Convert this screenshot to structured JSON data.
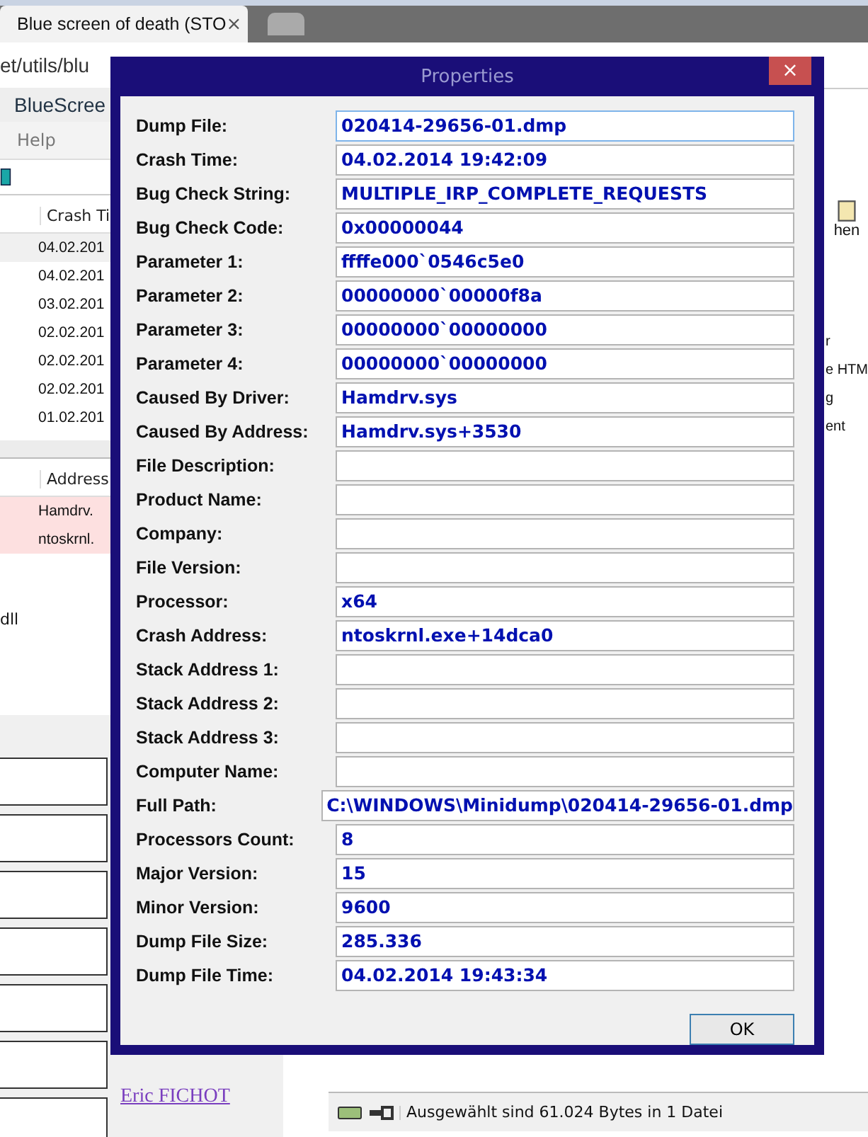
{
  "browser": {
    "tab_title": "Blue screen of death (STO",
    "tab_close": "×",
    "address": "et/utils/blu"
  },
  "app_window": {
    "title": "BlueScree",
    "menu": [
      "Help"
    ],
    "crash_list": {
      "column": "Crash Ti",
      "rows": [
        "04.02.201",
        "04.02.201",
        "03.02.201",
        "02.02.201",
        "02.02.201",
        "02.02.201",
        "01.02.201"
      ]
    },
    "driver_list": {
      "column": "Address",
      "rows": [
        {
          "text": "Hamdrv.",
          "highlighted": true
        },
        {
          "text": "ntoskrnl.",
          "highlighted": true
        }
      ],
      "extra": "dll"
    },
    "right_panel": {
      "button_label": "hen",
      "items": [
        "r",
        "e HTM",
        "g",
        "ent"
      ]
    }
  },
  "web_page": {
    "link": "Eric FICHOT"
  },
  "status_bar": {
    "text": "Ausgewählt sind 61.024 Bytes in 1 Datei"
  },
  "dialog": {
    "title": "Properties",
    "close": "×",
    "ok": "OK",
    "fields": [
      {
        "label": "Dump File:",
        "value": "020414-29656-01.dmp",
        "focused": true
      },
      {
        "label": "Crash Time:",
        "value": "04.02.2014 19:42:09",
        "focused": false
      },
      {
        "label": "Bug Check String:",
        "value": "MULTIPLE_IRP_COMPLETE_REQUESTS",
        "focused": false
      },
      {
        "label": "Bug Check Code:",
        "value": "0x00000044",
        "focused": false
      },
      {
        "label": "Parameter 1:",
        "value": "ffffe000`0546c5e0",
        "focused": false
      },
      {
        "label": "Parameter 2:",
        "value": "00000000`00000f8a",
        "focused": false
      },
      {
        "label": "Parameter 3:",
        "value": "00000000`00000000",
        "focused": false
      },
      {
        "label": "Parameter 4:",
        "value": "00000000`00000000",
        "focused": false
      },
      {
        "label": "Caused By Driver:",
        "value": "Hamdrv.sys",
        "focused": false
      },
      {
        "label": "Caused By Address:",
        "value": "Hamdrv.sys+3530",
        "focused": false
      },
      {
        "label": "File Description:",
        "focused": false
      },
      {
        "label": "Product Name:",
        "focused": false
      },
      {
        "label": "Company:",
        "focused": false
      },
      {
        "label": "File Version:",
        "focused": false
      },
      {
        "label": "Processor:",
        "value": "x64",
        "focused": false
      },
      {
        "label": "Crash Address:",
        "value": "ntoskrnl.exe+14dca0",
        "focused": false
      },
      {
        "label": "Stack Address 1:",
        "focused": false
      },
      {
        "label": "Stack Address 2:",
        "focused": false
      },
      {
        "label": "Stack Address 3:",
        "focused": false
      },
      {
        "label": "Computer Name:",
        "focused": false
      },
      {
        "label": "Full Path:",
        "value": "C:\\WINDOWS\\Minidump\\020414-29656-01.dmp",
        "focused": false
      },
      {
        "label": "Processors Count:",
        "value": "8",
        "focused": false
      },
      {
        "label": "Major Version:",
        "value": "15",
        "focused": false
      },
      {
        "label": "Minor Version:",
        "value": "9600",
        "focused": false
      },
      {
        "label": "Dump File Size:",
        "value": "285.336",
        "focused": false
      },
      {
        "label": "Dump File Time:",
        "value": "04.02.2014 19:43:34",
        "focused": false
      }
    ]
  }
}
